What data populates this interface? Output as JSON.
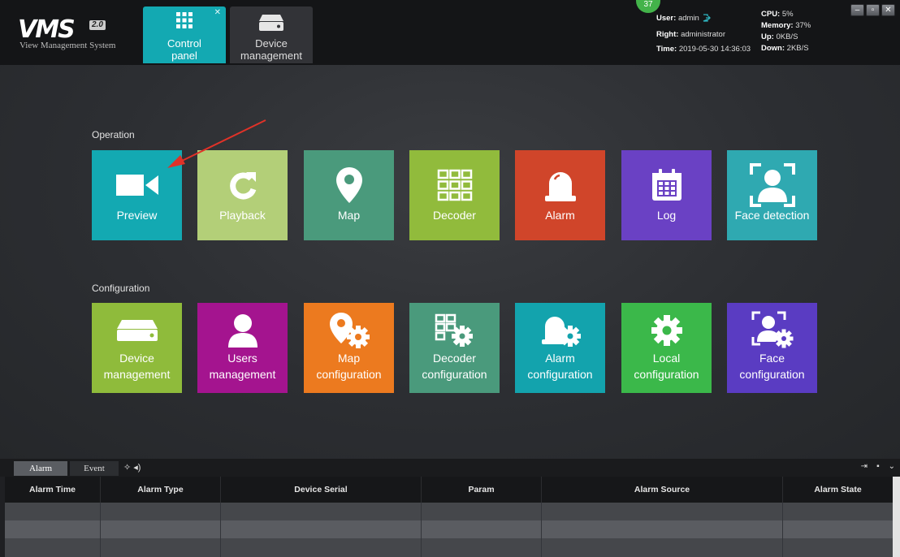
{
  "app": {
    "logo_text": "VMS",
    "logo_version": "2.0",
    "logo_subtitle": "View Management System"
  },
  "tabs": [
    {
      "label_line1": "Control",
      "label_line2": "panel",
      "icon": "grid-icon",
      "active": true
    },
    {
      "label_line1": "Device",
      "label_line2": "management",
      "icon": "nvr-device-icon",
      "active": false
    }
  ],
  "notification_count": "37",
  "user": {
    "user_label": "User:",
    "user_value": "admin",
    "right_label": "Right:",
    "right_value": "administrator",
    "time_label": "Time:",
    "time_value": "2019-05-30 14:36:03"
  },
  "system": {
    "cpu_label": "CPU:",
    "cpu_value": "5%",
    "memory_label": "Memory:",
    "memory_value": "37%",
    "up_label": "Up:",
    "up_value": "0KB/S",
    "down_label": "Down:",
    "down_value": "2KB/S"
  },
  "window_buttons": {
    "minimize": "–",
    "maximize": "▫",
    "close": "✕"
  },
  "operation": {
    "title": "Operation",
    "tiles": [
      {
        "label": "Preview",
        "color": "#13a9b2",
        "icon": "video-camera-icon"
      },
      {
        "label": "Playback",
        "color": "#b3cf78",
        "icon": "refresh-icon"
      },
      {
        "label": "Map",
        "color": "#4a9a7c",
        "icon": "map-pin-icon"
      },
      {
        "label": "Decoder",
        "color": "#91bb3c",
        "icon": "decoder-grid-icon"
      },
      {
        "label": "Alarm",
        "color": "#d0452a",
        "icon": "alarm-siren-icon"
      },
      {
        "label": "Log",
        "color": "#6a41c4",
        "icon": "calendar-icon"
      },
      {
        "label": "Face detection",
        "color": "#2fa9b1",
        "icon": "face-scan-icon"
      }
    ]
  },
  "configuration": {
    "title": "Configuration",
    "tiles": [
      {
        "line1": "Device",
        "line2": "management",
        "color": "#8fbb3b",
        "icon": "nvr-device-icon"
      },
      {
        "line1": "Users",
        "line2": "management",
        "color": "#a4148f",
        "icon": "user-icon"
      },
      {
        "line1": "Map",
        "line2": "configuration",
        "color": "#ec7a1f",
        "icon": "map-gear-icon"
      },
      {
        "line1": "Decoder",
        "line2": "configuration",
        "color": "#4a9a7c",
        "icon": "decoder-gear-icon"
      },
      {
        "line1": "Alarm",
        "line2": "configuration",
        "color": "#13a3ad",
        "icon": "alarm-gear-icon"
      },
      {
        "line1": "Local",
        "line2": "configuration",
        "color": "#3bb84a",
        "icon": "gear-icon"
      },
      {
        "line1": "Face",
        "line2": "configuration",
        "color": "#5a3cc2",
        "icon": "face-gear-icon"
      }
    ]
  },
  "bottom_panel": {
    "tabs": [
      "Alarm",
      "Event"
    ],
    "columns": [
      "Alarm Time",
      "Alarm Type",
      "Device Serial",
      "Param",
      "Alarm Source",
      "Alarm State"
    ],
    "rows": []
  }
}
